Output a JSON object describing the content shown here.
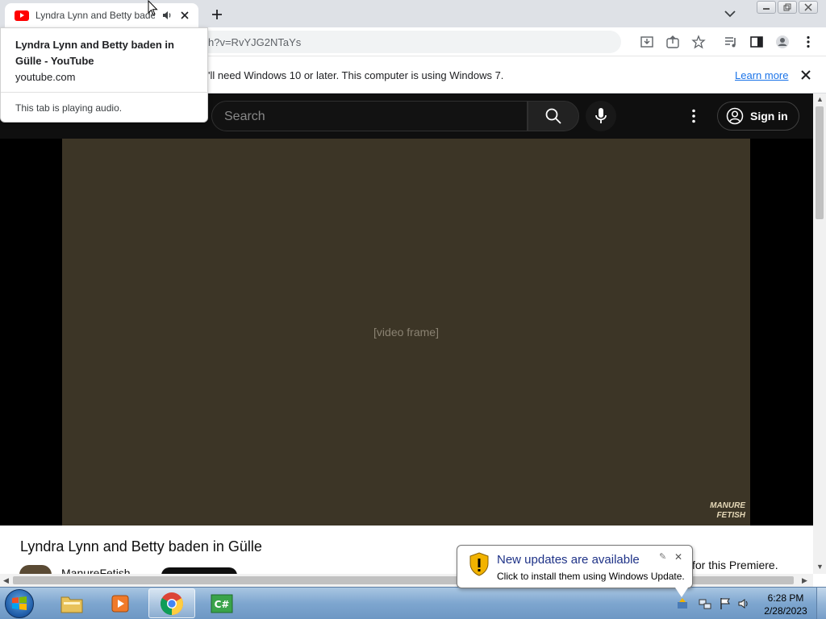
{
  "browser": {
    "tab": {
      "title": "Lyndra Lynn and Betty baden in Gülle - YouTube",
      "title_visible": "Lyndra Lynn and Betty bade"
    },
    "url_fragment": "h?v=RvYJG2NTaYs",
    "infobar": {
      "message_fragment": "'ll need Windows 10 or later. This computer is using Windows 7.",
      "link": "Learn more"
    },
    "hovercard": {
      "title": "Lyndra Lynn and Betty baden in Gülle - YouTube",
      "host": "youtube.com",
      "audio_status": "This tab is playing audio."
    }
  },
  "youtube": {
    "search_placeholder": "Search",
    "sign_in": "Sign in",
    "video_title": "Lyndra Lynn and Betty baden in Gülle",
    "channel_name": "ManureFetish",
    "premiere_fragment": "for this Premiere.",
    "watermark_line1": "MANURE",
    "watermark_line2": "FETISH"
  },
  "notification": {
    "title": "New updates are available",
    "subtitle": "Click to install them using Windows Update."
  },
  "taskbar": {
    "time": "6:28 PM",
    "date": "2/28/2023",
    "active_app": "chrome"
  },
  "colors": {
    "youtube_red": "#ff0000",
    "link_blue": "#1a73e8",
    "yt_dark": "#0f0f0f",
    "balloon_title": "#1e3287"
  }
}
